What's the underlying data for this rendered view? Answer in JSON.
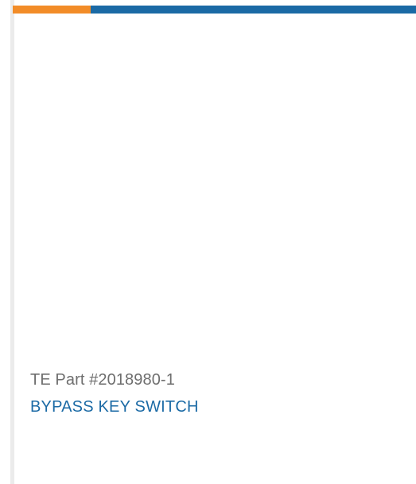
{
  "card": {
    "part_number": "TE Part #2018980-1",
    "product_title": "BYPASS KEY SWITCH"
  },
  "colors": {
    "accent_orange": "#f28c28",
    "accent_blue": "#1b6aa5",
    "part_number_text": "#6e6e6e",
    "title_link": "#1b6aa5"
  }
}
